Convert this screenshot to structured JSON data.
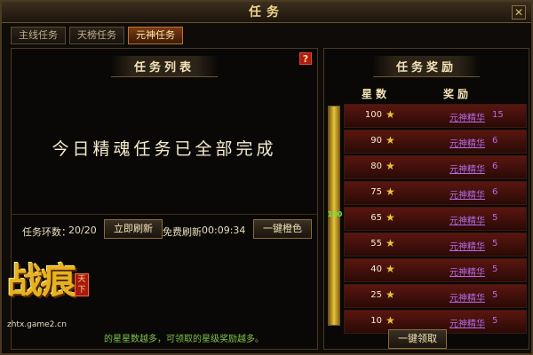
{
  "window": {
    "title": "任务"
  },
  "tabs": [
    {
      "label": "主线任务"
    },
    {
      "label": "天榜任务"
    },
    {
      "label": "元神任务"
    }
  ],
  "task_list": {
    "header": "任务列表",
    "help_glyph": "?",
    "completed_message": "今日精魂任务已全部完成",
    "ring_label": "任务环数：",
    "ring_value": "20/20",
    "refresh_button": "立即刷新",
    "free_refresh_label": "免费刷新",
    "free_refresh_timer": "00:09:34",
    "orange_button": "一键橙色",
    "footer_message": "的星星数越多，可领取的星级奖励越多。"
  },
  "rewards": {
    "header": "任务奖励",
    "col_stars": "星数",
    "col_reward": "奖励",
    "progress_label": "100",
    "progress_fraction": 1.0,
    "star_icon": "star-icon",
    "rows": [
      {
        "stars": "100",
        "item": "元神精华",
        "qty": "15"
      },
      {
        "stars": "90",
        "item": "元神精华",
        "qty": "6"
      },
      {
        "stars": "80",
        "item": "元神精华",
        "qty": "6"
      },
      {
        "stars": "75",
        "item": "元神精华",
        "qty": "6"
      },
      {
        "stars": "65",
        "item": "元神精华",
        "qty": "5"
      },
      {
        "stars": "55",
        "item": "元神精华",
        "qty": "5"
      },
      {
        "stars": "40",
        "item": "元神精华",
        "qty": "5"
      },
      {
        "stars": "25",
        "item": "元神精华",
        "qty": "5"
      },
      {
        "stars": "10",
        "item": "元神精华",
        "qty": "5"
      }
    ],
    "claim_button": "一键领取"
  },
  "watermark": {
    "logo_text": "战痕",
    "seal_text": "天下",
    "url": "zhtx.game2.cn"
  },
  "colors": {
    "accent_gold": "#e8c23a",
    "reward_purple": "#b56ae8",
    "footer_green": "#7ec44a",
    "active_tab": "#7b3b14"
  }
}
